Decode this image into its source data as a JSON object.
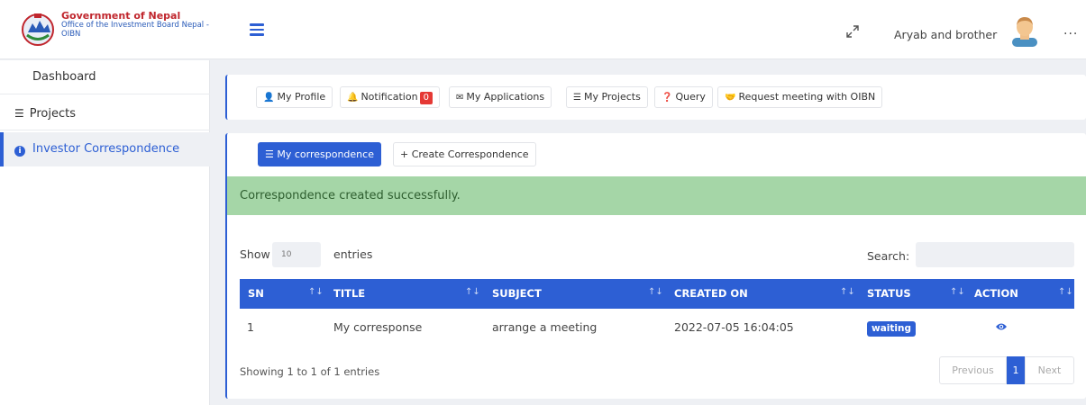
{
  "header": {
    "org_line1": "Government of Nepal",
    "org_line2": "Office of the Investment Board Nepal -",
    "org_line3": "OIBN",
    "username": "Aryab and brother",
    "more": "···"
  },
  "sidebar": {
    "items": [
      {
        "label": "Dashboard"
      },
      {
        "label": "Projects",
        "icon": "list-icon"
      },
      {
        "label": "Investor Correspondence",
        "icon": "info-icon",
        "active": true
      }
    ]
  },
  "topnav": {
    "profile": "My Profile",
    "notification": "Notification",
    "notification_count": "0",
    "applications": "My Applications",
    "projects": "My Projects",
    "query": "Query",
    "meeting": "Request meeting with OIBN"
  },
  "tabs": {
    "my_correspondence": "My correspondence",
    "create": "Create Correspondence"
  },
  "alert": "Correspondence created successfully.",
  "table_controls": {
    "show": "Show",
    "page_size": "10",
    "entries": "entries",
    "search": "Search:"
  },
  "table": {
    "columns": [
      "SN",
      "TITLE",
      "SUBJECT",
      "CREATED ON",
      "STATUS",
      "ACTION"
    ],
    "rows": [
      {
        "sn": "1",
        "title": "My corresponse",
        "subject": "arrange a meeting",
        "created_on": "2022-07-05 16:04:05",
        "status": "waiting"
      }
    ]
  },
  "footer": {
    "info": "Showing 1 to 1 of 1 entries",
    "prev": "Previous",
    "page": "1",
    "next": "Next"
  },
  "colors": {
    "accent": "#2d5fd4",
    "success_bg": "#a5d6a7",
    "danger": "#e53935",
    "brand_red": "#c0262d"
  }
}
